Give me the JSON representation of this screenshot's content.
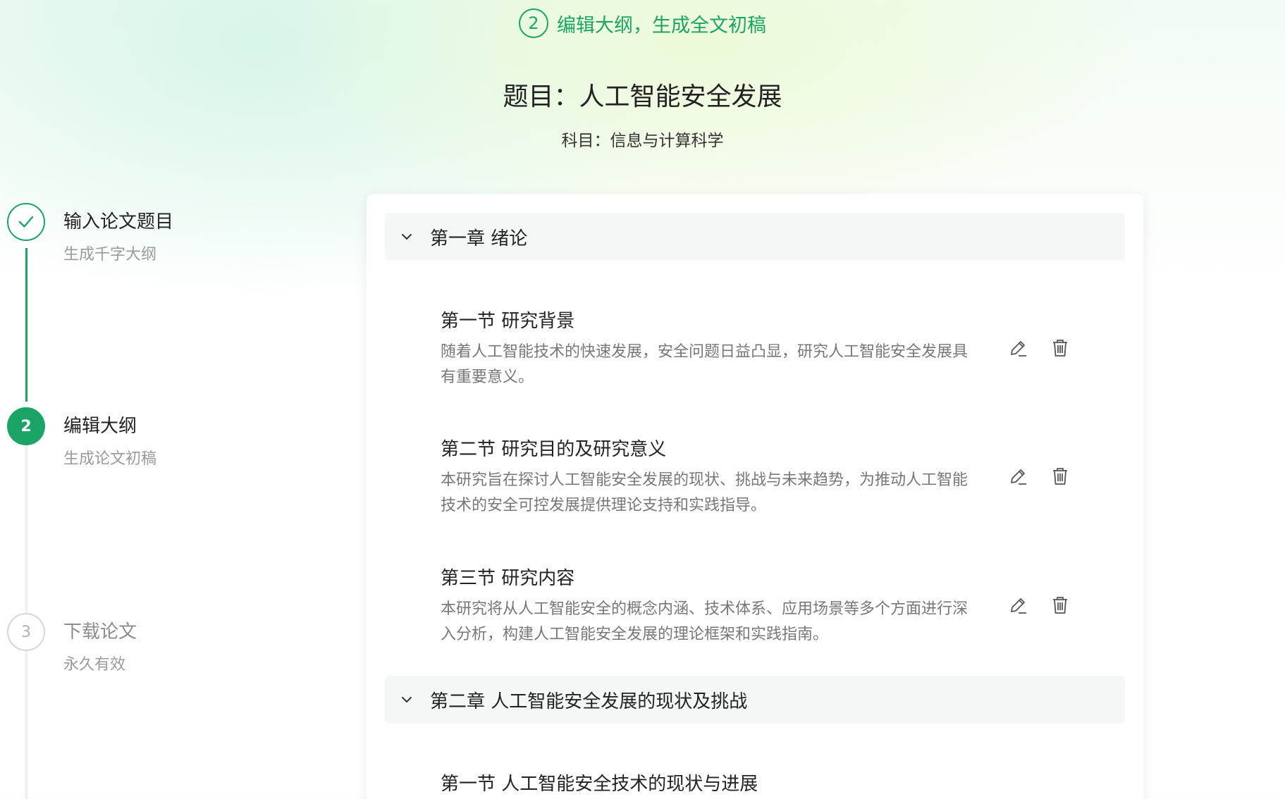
{
  "header": {
    "step_number": "2",
    "step_label": "编辑大纲，生成全文初稿",
    "title": "题目：人工智能安全发展",
    "subject": "科目：信息与计算科学"
  },
  "stepper": [
    {
      "number": "",
      "title": "输入论文题目",
      "subtitle": "生成千字大纲",
      "state": "done"
    },
    {
      "number": "2",
      "title": "编辑大纲",
      "subtitle": "生成论文初稿",
      "state": "active"
    },
    {
      "number": "3",
      "title": "下载论文",
      "subtitle": "永久有效",
      "state": "pending"
    }
  ],
  "outline": [
    {
      "chapter": "第一章 绪论",
      "sections": [
        {
          "title": "第一节 研究背景",
          "desc": "随着人工智能技术的快速发展，安全问题日益凸显，研究人工智能安全发展具有重要意义。"
        },
        {
          "title": "第二节 研究目的及研究意义",
          "desc": "本研究旨在探讨人工智能安全发展的现状、挑战与未来趋势，为推动人工智能技术的安全可控发展提供理论支持和实践指导。"
        },
        {
          "title": "第三节 研究内容",
          "desc": "本研究将从人工智能安全的概念内涵、技术体系、应用场景等多个方面进行深入分析，构建人工智能安全发展的理论框架和实践指南。"
        }
      ]
    },
    {
      "chapter": "第二章 人工智能安全发展的现状及挑战",
      "sections": [
        {
          "title": "第一节 人工智能安全技术的现状与进展",
          "desc": ""
        }
      ]
    }
  ],
  "colors": {
    "accent": "#1aa567",
    "muted": "#9a9a9a",
    "chapter_bg": "#f5f7f7"
  },
  "icons": {
    "edit": "pencil-icon",
    "delete": "trash-icon",
    "chevron": "chevron-down-icon",
    "check": "check-icon"
  }
}
